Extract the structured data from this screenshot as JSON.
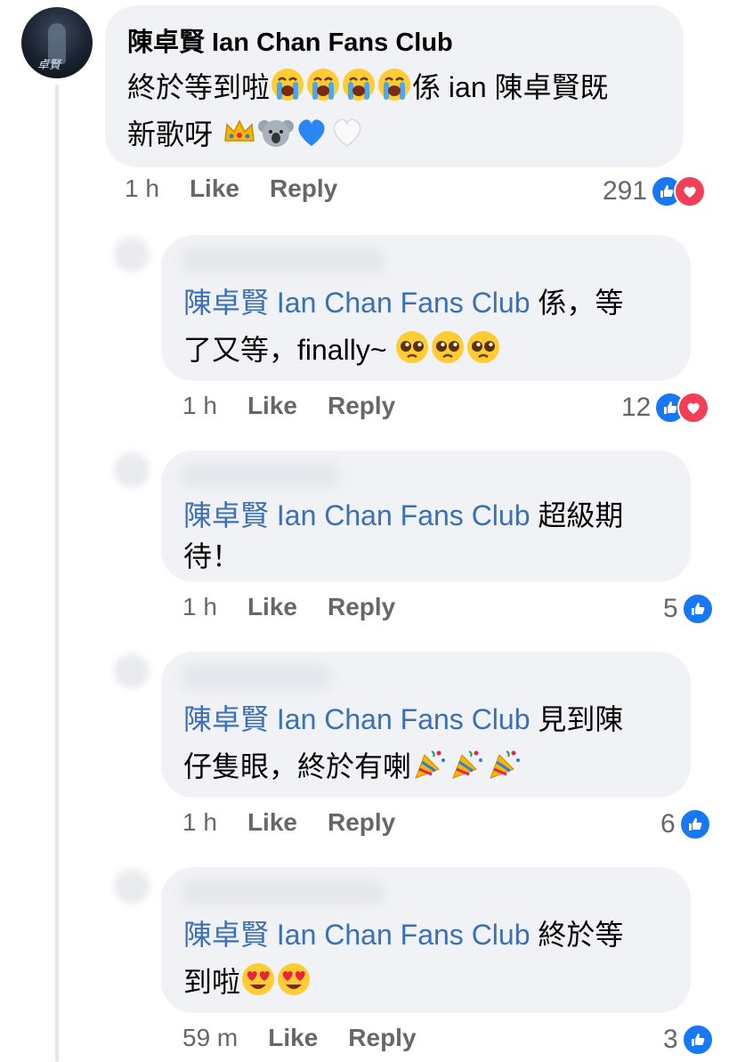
{
  "colors": {
    "tag": "#3b6fb6",
    "bubble": "#f0f2f5",
    "like": "#1877f2",
    "love": "#f33e58"
  },
  "main_comment": {
    "author": "陳卓賢 Ian Chan Fans Club",
    "text_line1": "終於等到啦",
    "text_line1_after": "係 ian 陳卓賢既",
    "text_line2": "新歌呀",
    "emojis_line1": [
      "loudly-crying-face",
      "loudly-crying-face",
      "loudly-crying-face",
      "loudly-crying-face"
    ],
    "emojis_line2": [
      "crown",
      "koala",
      "blue-heart",
      "white-heart"
    ],
    "time": "1 h",
    "like_label": "Like",
    "reply_label": "Reply",
    "reaction_count": "291",
    "reactions": [
      "like-icon",
      "love-icon"
    ]
  },
  "replies": [
    {
      "tag": "陳卓賢 Ian Chan Fans Club",
      "text_a": "係，等",
      "text_b": "了又等，finally~",
      "emojis": [
        "pleading-face",
        "pleading-face",
        "pleading-face"
      ],
      "time": "1 h",
      "like_label": "Like",
      "reply_label": "Reply",
      "count": "12",
      "reactions": [
        "like-icon",
        "love-icon"
      ]
    },
    {
      "tag": "陳卓賢 Ian Chan Fans Club",
      "text_a": "超級期",
      "text_b": "待！",
      "emojis": [],
      "time": "1 h",
      "like_label": "Like",
      "reply_label": "Reply",
      "count": "5",
      "reactions": [
        "like-icon"
      ]
    },
    {
      "tag": "陳卓賢 Ian Chan Fans Club",
      "text_a": "見到陳",
      "text_b": "仔隻眼，終於有喇",
      "emojis": [
        "party-popper",
        "party-popper",
        "party-popper"
      ],
      "time": "1 h",
      "like_label": "Like",
      "reply_label": "Reply",
      "count": "6",
      "reactions": [
        "like-icon"
      ]
    },
    {
      "tag": "陳卓賢 Ian Chan Fans Club",
      "text_a": "終於等",
      "text_b": "到啦",
      "emojis": [
        "heart-eyes-face",
        "heart-eyes-face"
      ],
      "time": "59 m",
      "like_label": "Like",
      "reply_label": "Reply",
      "count": "3",
      "reactions": [
        "like-icon"
      ]
    }
  ]
}
